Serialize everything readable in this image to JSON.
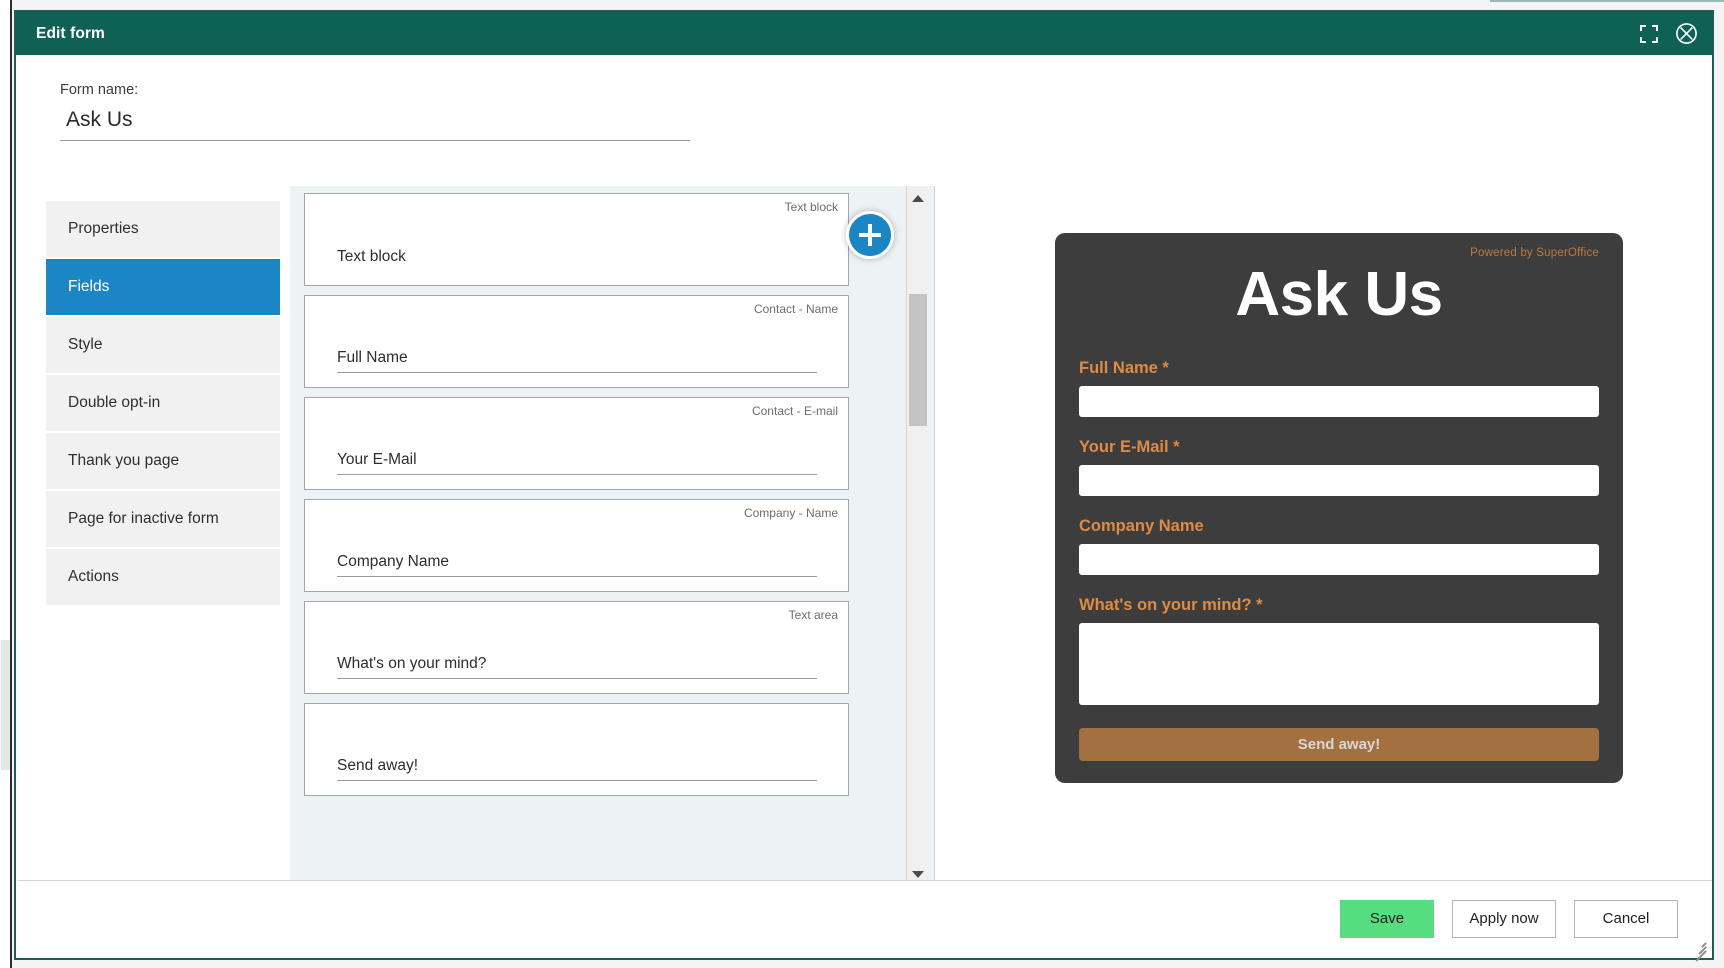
{
  "window": {
    "title": "Edit form",
    "expand_icon": "expand-icon",
    "close_icon": "close-circle-icon"
  },
  "form_name_section": {
    "label": "Form name:",
    "value": "Ask Us",
    "placeholder": "Form name"
  },
  "sidebar": {
    "items": [
      {
        "label": "Properties",
        "active": false
      },
      {
        "label": "Fields",
        "active": true
      },
      {
        "label": "Style",
        "active": false
      },
      {
        "label": "Double opt-in",
        "active": false
      },
      {
        "label": "Thank you page",
        "active": false
      },
      {
        "label": "Page for inactive form",
        "active": false
      },
      {
        "label": "Actions",
        "active": false
      }
    ]
  },
  "fields_panel": {
    "add_button_label": "+",
    "scroll_up_icon": "chevron-up-icon",
    "scroll_down_icon": "chevron-down-icon",
    "cards": [
      {
        "type": "Text block",
        "value": "Text block",
        "underlined": false
      },
      {
        "type": "Contact - Name",
        "value": "Full Name",
        "underlined": true
      },
      {
        "type": "Contact - E-mail",
        "value": "Your E-Mail",
        "underlined": true
      },
      {
        "type": "Company - Name",
        "value": "Company Name",
        "underlined": true
      },
      {
        "type": "Text area",
        "value": "What's on your mind?",
        "underlined": true
      },
      {
        "type": "",
        "value": "Send away!",
        "underlined": true
      }
    ]
  },
  "preview": {
    "powered_by": "Powered by SuperOffice",
    "title": "Ask Us",
    "fields": [
      {
        "label": "Full Name *",
        "value": "",
        "control": "input"
      },
      {
        "label": "Your E-Mail *",
        "value": "",
        "control": "input"
      },
      {
        "label": "Company Name",
        "value": "",
        "control": "input"
      },
      {
        "label": "What's on your mind? *",
        "value": "",
        "control": "textarea"
      }
    ],
    "submit_label": "Send away!",
    "colors": {
      "background": "#3d3d3d",
      "label": "#de8b46",
      "submit_background": "#a3703f",
      "submit_text": "#d8d8d8",
      "powered_by": "#c07a3e"
    }
  },
  "footer": {
    "save_label": "Save",
    "apply_label": "Apply now",
    "cancel_label": "Cancel"
  },
  "theme": {
    "titlebar": "#0f6156",
    "accent": "#1b86c4",
    "save_green": "#55dd7f"
  }
}
